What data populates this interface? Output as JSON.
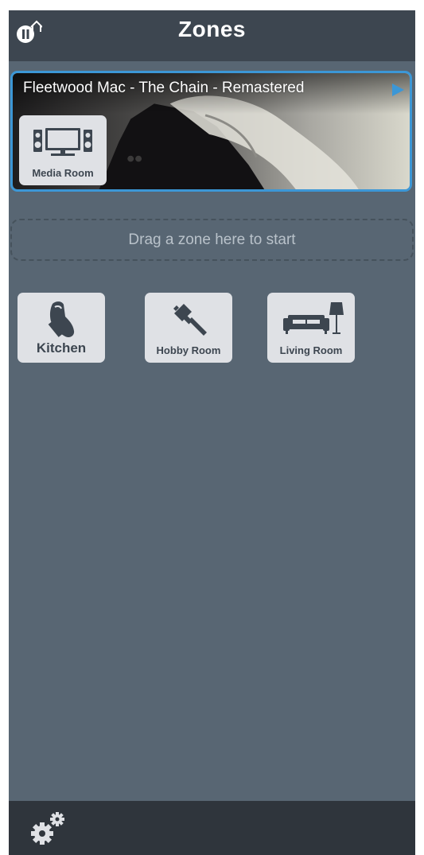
{
  "header": {
    "title": "Zones",
    "home_icon": "home-pause-icon"
  },
  "now_playing": {
    "track": "Fleetwood Mac - The Chain - Remastered",
    "play_icon": "play-icon",
    "accent_color": "#3c97d6",
    "zone": {
      "label": "Media Room",
      "icon": "tv-speakers-icon"
    }
  },
  "drop_zone": {
    "text": "Drag a zone here to start"
  },
  "zones": [
    {
      "label": "Kitchen",
      "icon": "oven-mitt-icon"
    },
    {
      "label": "Hobby Room",
      "icon": "paintbrush-icon"
    },
    {
      "label": "Living Room",
      "icon": "sofa-lamp-icon"
    }
  ],
  "footer": {
    "settings_icon": "gears-icon"
  }
}
